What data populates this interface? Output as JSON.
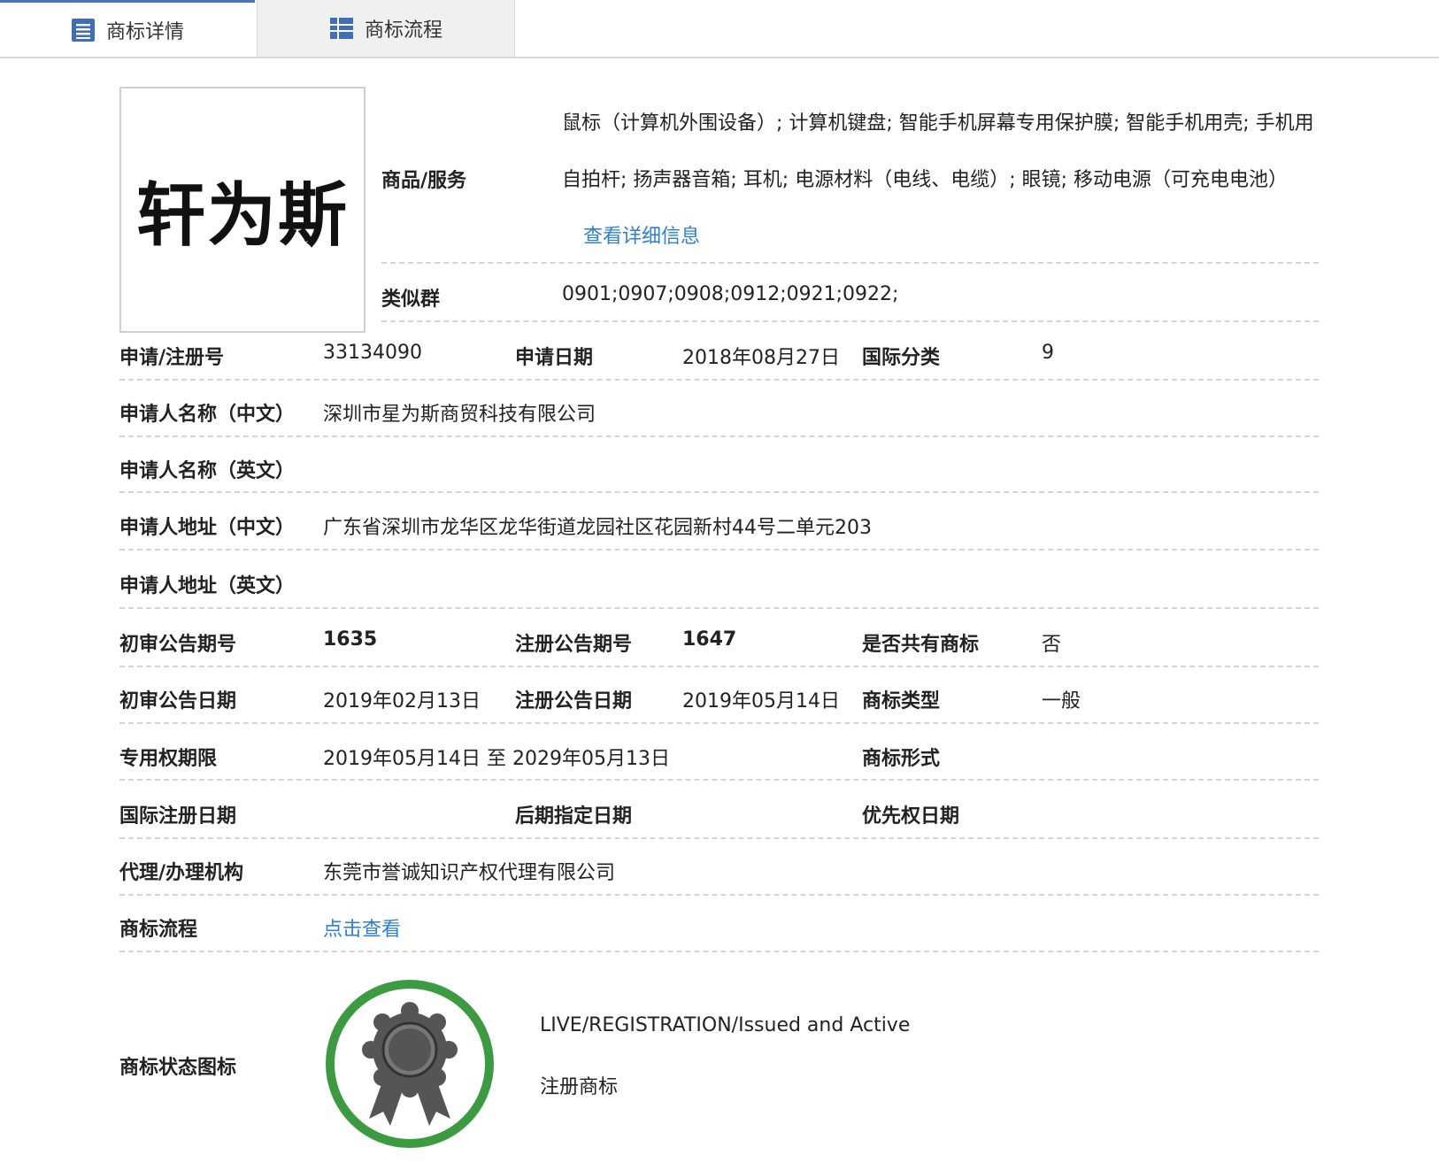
{
  "tabs": [
    {
      "label": "商标详情",
      "active": true,
      "icon": "list-icon"
    },
    {
      "label": "商标流程",
      "active": false,
      "icon": "grid-list-icon"
    }
  ],
  "mark": {
    "text": "轩为斯"
  },
  "goods": {
    "label": "商品/服务",
    "text": "鼠标（计算机外围设备）; 计算机键盘; 智能手机屏幕专用保护膜; 智能手机用壳; 手机用自拍杆; 扬声器音箱; 耳机; 电源材料（电线、电缆）; 眼镜; 移动电源（可充电电池）",
    "detail_link": "查看详细信息"
  },
  "similar": {
    "label": "类似群",
    "value": "0901;0907;0908;0912;0921;0922;"
  },
  "rows": {
    "reg_no": {
      "label": "申请/注册号",
      "value": "33134090"
    },
    "apply_date": {
      "label": "申请日期",
      "value": "2018年08月27日"
    },
    "intl_class": {
      "label": "国际分类",
      "value": "9"
    },
    "applicant_cn": {
      "label": "申请人名称（中文）",
      "value": "深圳市星为斯商贸科技有限公司"
    },
    "applicant_en": {
      "label": "申请人名称（英文）",
      "value": ""
    },
    "address_cn": {
      "label": "申请人地址（中文）",
      "value": "广东省深圳市龙华区龙华街道龙园社区花园新村44号二单元203"
    },
    "address_en": {
      "label": "申请人地址（英文）",
      "value": ""
    },
    "prelim_issue": {
      "label": "初审公告期号",
      "value": "1635"
    },
    "reg_issue": {
      "label": "注册公告期号",
      "value": "1647"
    },
    "shared": {
      "label": "是否共有商标",
      "value": "否"
    },
    "prelim_date": {
      "label": "初审公告日期",
      "value": "2019年02月13日"
    },
    "reg_date": {
      "label": "注册公告日期",
      "value": "2019年05月14日"
    },
    "mark_type": {
      "label": "商标类型",
      "value": "一般"
    },
    "exclusive_term": {
      "label": "专用权期限",
      "value": "2019年05月14日 至 2029年05月13日"
    },
    "mark_form": {
      "label": "商标形式",
      "value": ""
    },
    "intl_reg_date": {
      "label": "国际注册日期",
      "value": ""
    },
    "later_date": {
      "label": "后期指定日期",
      "value": ""
    },
    "priority_date": {
      "label": "优先权日期",
      "value": ""
    },
    "agent": {
      "label": "代理/办理机构",
      "value": "东莞市誉诚知识产权代理有限公司"
    },
    "process": {
      "label": "商标流程",
      "value": "点击查看"
    },
    "status": {
      "label": "商标状态图标",
      "line1": "LIVE/REGISTRATION/Issued and Active",
      "line2": "注册商标"
    }
  },
  "colors": {
    "link": "#2d7fd0",
    "tab_accent": "#4a78b6",
    "badge_ring": "#3c9a41",
    "badge_rosette": "#555555"
  }
}
